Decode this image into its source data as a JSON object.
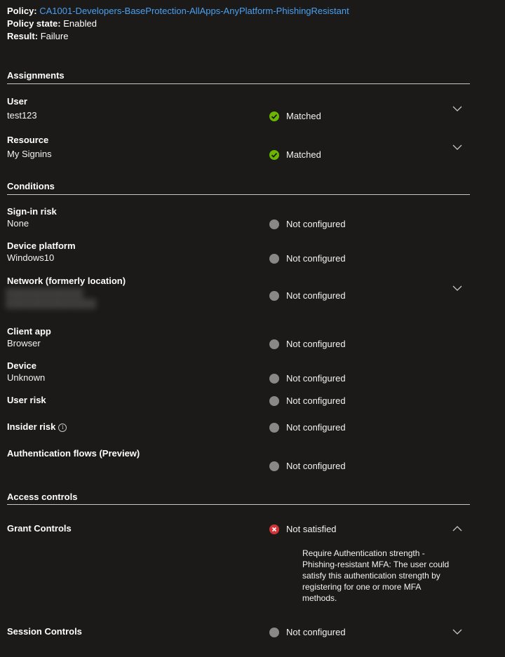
{
  "header": {
    "policy_label": "Policy:",
    "policy_name": "CA1001-Developers-BaseProtection-AllApps-AnyPlatform-PhishingResistant",
    "state_label": "Policy state:",
    "state_value": "Enabled",
    "result_label": "Result:",
    "result_value": "Failure"
  },
  "assignments": {
    "title": "Assignments",
    "user": {
      "label": "User",
      "value": "test123",
      "status": "Matched"
    },
    "resource": {
      "label": "Resource",
      "value": "My Signins",
      "status": "Matched"
    }
  },
  "conditions": {
    "title": "Conditions",
    "signin_risk": {
      "label": "Sign-in risk",
      "value": "None",
      "status": "Not configured"
    },
    "device_platform": {
      "label": "Device platform",
      "value": "Windows10",
      "status": "Not configured"
    },
    "network": {
      "label": "Network (formerly location)",
      "status": "Not configured"
    },
    "client_app": {
      "label": "Client app",
      "value": "Browser",
      "status": "Not configured"
    },
    "device": {
      "label": "Device",
      "value": "Unknown",
      "status": "Not configured"
    },
    "user_risk": {
      "label": "User risk",
      "status": "Not configured"
    },
    "insider_risk": {
      "label": "Insider risk",
      "status": "Not configured"
    },
    "auth_flows": {
      "label": "Authentication flows (Preview)",
      "status": "Not configured"
    }
  },
  "access_controls": {
    "title": "Access controls",
    "grant": {
      "label": "Grant Controls",
      "status": "Not satisfied",
      "detail": "Require Authentication strength - Phishing-resistant MFA: The user could satisfy this authentication strength by registering for one or more MFA methods."
    },
    "session": {
      "label": "Session Controls",
      "status": "Not configured"
    }
  },
  "colors": {
    "background": "#1b1a19",
    "link": "#4aa0f0",
    "matched": "#6bb700",
    "failed": "#d13438",
    "not_configured": "#8a8886"
  }
}
